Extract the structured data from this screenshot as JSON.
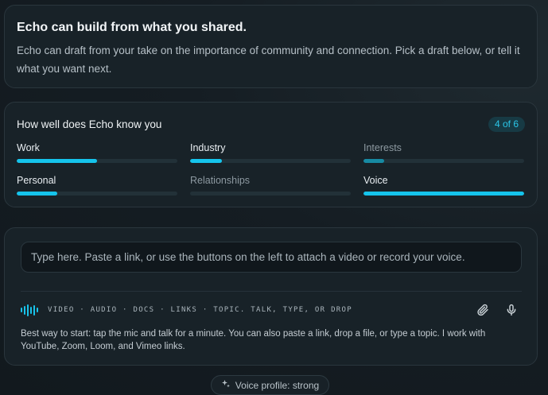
{
  "intro": {
    "title": "Echo can build from what you shared.",
    "body": "Echo can draft from your take on the importance of community and connection. Pick a draft below, or tell it what you want next."
  },
  "knowledge": {
    "title": "How well does Echo know you",
    "badge": "4 of 6",
    "metrics": [
      {
        "label": "Work",
        "progress": 0.5,
        "active": true
      },
      {
        "label": "Industry",
        "progress": 0.2,
        "active": true
      },
      {
        "label": "Interests",
        "progress": 0.13,
        "active": false
      },
      {
        "label": "Personal",
        "progress": 0.25,
        "active": true
      },
      {
        "label": "Relationships",
        "progress": 0.0,
        "active": false
      },
      {
        "label": "Voice",
        "progress": 1.0,
        "active": true
      }
    ]
  },
  "composer": {
    "placeholder": "Type here. Paste a link, or use the buttons on the left to attach a video or record your voice.",
    "modes": "VIDEO · AUDIO · DOCS · LINKS · TOPIC. TALK, TYPE, OR DROP",
    "hint": "Best way to start: tap the mic and talk for a minute. You can also paste a link, drop a file, or type a topic. I work with YouTube, Zoom, Loom, and Vimeo links.",
    "icons": {
      "wave": "waveform-icon",
      "attach": "paperclip-icon",
      "mic": "microphone-icon"
    }
  },
  "voice_profile": {
    "label": "Voice profile: strong",
    "icon": "sparkle-icon"
  },
  "colors": {
    "accent": "#15c4ec",
    "accent_dim": "#178aa3",
    "card_bg": "#182228"
  }
}
